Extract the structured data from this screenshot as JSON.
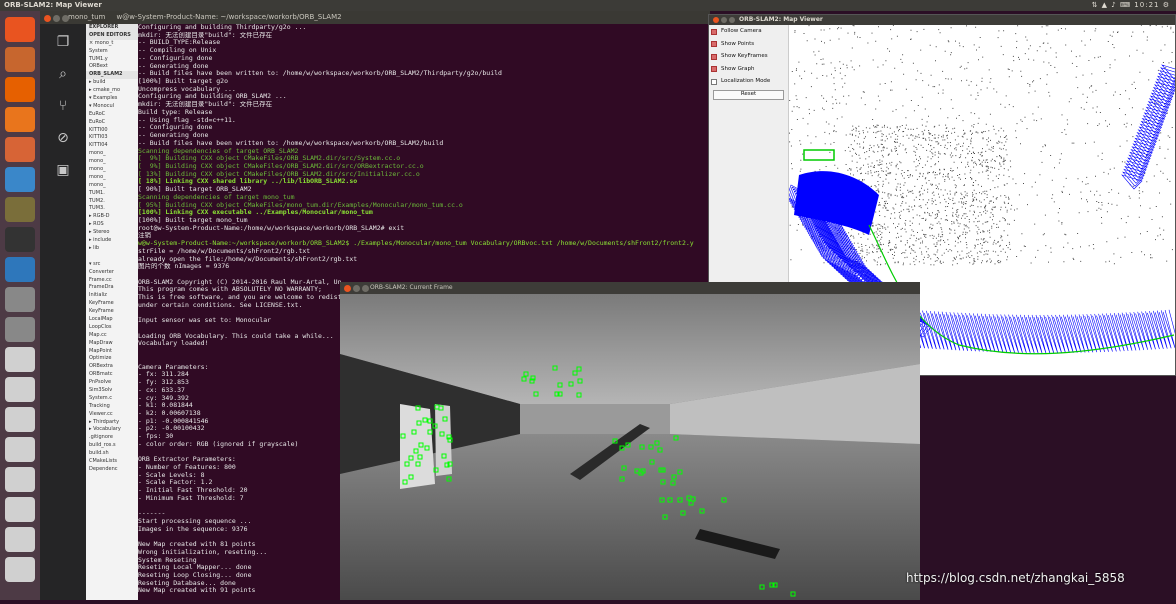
{
  "topbar": {
    "title": "ORB-SLAM2: Map Viewer",
    "clock": "10:21"
  },
  "launcher": {
    "icons": [
      "ubuntu-dash-icon",
      "files-icon",
      "firefox-icon",
      "libreoffice-icon",
      "software-center-icon",
      "chromium-icon",
      "sublime-icon",
      "terminal-icon",
      "settings-icon",
      "help-icon",
      "help-icon",
      "disk-icon",
      "disk-icon",
      "disk-icon",
      "disk-icon",
      "disk-icon",
      "disk-icon",
      "disk-icon",
      "disk-icon"
    ]
  },
  "terminal": {
    "title": "mono_tum",
    "title2": "w@w-System-Product-Name: ~/workspace/workorb/ORB_SLAM2",
    "lines": [
      {
        "t": "Configuring and building Thirdparty/g2o ...",
        "c": ""
      },
      {
        "t": "mkdir: 无法创建目录\"build\": 文件已存在",
        "c": ""
      },
      {
        "t": "-- BUILD_TYPE:Release",
        "c": ""
      },
      {
        "t": "-- Compiling on Unix",
        "c": ""
      },
      {
        "t": "-- Configuring done",
        "c": ""
      },
      {
        "t": "-- Generating done",
        "c": ""
      },
      {
        "t": "-- Build files have been written to: /home/w/workspace/workorb/ORB_SLAM2/Thirdparty/g2o/build",
        "c": ""
      },
      {
        "t": "[100%] Built target g2o",
        "c": ""
      },
      {
        "t": "Uncompress vocabulary ...",
        "c": ""
      },
      {
        "t": "Configuring and building ORB_SLAM2 ...",
        "c": ""
      },
      {
        "t": "mkdir: 无法创建目录\"build\": 文件已存在",
        "c": ""
      },
      {
        "t": "Build type: Release",
        "c": ""
      },
      {
        "t": "-- Using flag -std=c++11.",
        "c": ""
      },
      {
        "t": "-- Configuring done",
        "c": ""
      },
      {
        "t": "-- Generating done",
        "c": ""
      },
      {
        "t": "-- Build files have been written to: /home/w/workspace/workorb/ORB_SLAM2/build",
        "c": ""
      },
      {
        "t": "Scanning dependencies of target ORB_SLAM2",
        "c": "g"
      },
      {
        "t": "[  9%] Building CXX object CMakeFiles/ORB_SLAM2.dir/src/System.cc.o",
        "c": "g"
      },
      {
        "t": "[  9%] Building CXX object CMakeFiles/ORB_SLAM2.dir/src/ORBextractor.cc.o",
        "c": "g"
      },
      {
        "t": "[ 13%] Building CXX object CMakeFiles/ORB_SLAM2.dir/src/Initializer.cc.o",
        "c": "g"
      },
      {
        "t": "[ 18%] Linking CXX shared library ../lib/libORB_SLAM2.so",
        "c": "gb"
      },
      {
        "t": "[ 90%] Built target ORB_SLAM2",
        "c": ""
      },
      {
        "t": "Scanning dependencies of target mono_tum",
        "c": "g"
      },
      {
        "t": "[ 95%] Building CXX object CMakeFiles/mono_tum.dir/Examples/Monocular/mono_tum.cc.o",
        "c": "g"
      },
      {
        "t": "[100%] Linking CXX executable ../Examples/Monocular/mono_tum",
        "c": "gb"
      },
      {
        "t": "[100%] Built target mono_tum",
        "c": ""
      },
      {
        "t": "root@w-System-Product-Name:/home/w/workspace/workorb/ORB_SLAM2# exit",
        "c": ""
      },
      {
        "t": "注销",
        "c": ""
      },
      {
        "t": "w@w-System-Product-Name:~/workspace/workorb/ORB_SLAM2$ ./Examples/Monocular/mono_tum Vocabulary/ORBvoc.txt /home/w/Documents/shFront2/front2.y",
        "c": "pr"
      },
      {
        "t": "strFile = /home/w/Documents/shFront2/rgb.txt",
        "c": ""
      },
      {
        "t": "already open the file:/home/w/Documents/shFront2/rgb.txt",
        "c": ""
      },
      {
        "t": "图片的个数 nImages = 9376",
        "c": ""
      },
      {
        "t": "",
        "c": ""
      },
      {
        "t": "ORB-SLAM2 Copyright (C) 2014-2016 Raul Mur-Artal, Un",
        "c": ""
      },
      {
        "t": "This program comes with ABSOLUTELY NO WARRANTY;",
        "c": ""
      },
      {
        "t": "This is free software, and you are welcome to redist",
        "c": ""
      },
      {
        "t": "under certain conditions. See LICENSE.txt.",
        "c": ""
      },
      {
        "t": "",
        "c": ""
      },
      {
        "t": "Input sensor was set to: Monocular",
        "c": ""
      },
      {
        "t": "",
        "c": ""
      },
      {
        "t": "Loading ORB Vocabulary. This could take a while...",
        "c": ""
      },
      {
        "t": "Vocabulary loaded!",
        "c": ""
      },
      {
        "t": "",
        "c": ""
      },
      {
        "t": "",
        "c": ""
      },
      {
        "t": "Camera Parameters:",
        "c": ""
      },
      {
        "t": "- fx: 311.284",
        "c": ""
      },
      {
        "t": "- fy: 312.853",
        "c": ""
      },
      {
        "t": "- cx: 633.37",
        "c": ""
      },
      {
        "t": "- cy: 349.392",
        "c": ""
      },
      {
        "t": "- k1: 0.081844",
        "c": ""
      },
      {
        "t": "- k2: 0.00607138",
        "c": ""
      },
      {
        "t": "- p1: -0.000841546",
        "c": ""
      },
      {
        "t": "- p2: -0.00100432",
        "c": ""
      },
      {
        "t": "- fps: 30",
        "c": ""
      },
      {
        "t": "- color order: RGB (ignored if grayscale)",
        "c": ""
      },
      {
        "t": "",
        "c": ""
      },
      {
        "t": "ORB Extractor Parameters:",
        "c": ""
      },
      {
        "t": "- Number of Features: 800",
        "c": ""
      },
      {
        "t": "- Scale Levels: 8",
        "c": ""
      },
      {
        "t": "- Scale Factor: 1.2",
        "c": ""
      },
      {
        "t": "- Initial Fast Threshold: 20",
        "c": ""
      },
      {
        "t": "- Minimum Fast Threshold: 7",
        "c": ""
      },
      {
        "t": "",
        "c": ""
      },
      {
        "t": "-------",
        "c": ""
      },
      {
        "t": "Start processing sequence ...",
        "c": ""
      },
      {
        "t": "Images in the sequence: 9376",
        "c": ""
      },
      {
        "t": "",
        "c": ""
      },
      {
        "t": "New Map created with 81 points",
        "c": ""
      },
      {
        "t": "Wrong initialization, reseting...",
        "c": ""
      },
      {
        "t": "System Reseting",
        "c": ""
      },
      {
        "t": "Reseting Local Mapper... done",
        "c": ""
      },
      {
        "t": "Reseting Loop Closing... done",
        "c": ""
      },
      {
        "t": "Reseting Database... done",
        "c": ""
      },
      {
        "t": "New Map created with 91 points",
        "c": ""
      }
    ]
  },
  "explorer": {
    "items": [
      {
        "t": "EXPLORER",
        "s": 1
      },
      {
        "t": "OPEN EDITORS",
        "s": 1
      },
      {
        "t": "× mono_t",
        "s": 0
      },
      {
        "t": "  System",
        "s": 0
      },
      {
        "t": "  TUM1.y",
        "s": 0
      },
      {
        "t": "  ORBext",
        "s": 0
      },
      {
        "t": "ORB_SLAM2",
        "s": 1
      },
      {
        "t": "▸ build",
        "s": 0
      },
      {
        "t": "▸ cmake_mo",
        "s": 0
      },
      {
        "t": "▾ Examples",
        "s": 0
      },
      {
        "t": " ▾ Monocul",
        "s": 0
      },
      {
        "t": "  EuRoC",
        "s": 0
      },
      {
        "t": "  EuRoC",
        "s": 0
      },
      {
        "t": "  KITTI00",
        "s": 0
      },
      {
        "t": "  KITTI03",
        "s": 0
      },
      {
        "t": "  KITTI04",
        "s": 0
      },
      {
        "t": "  mono_",
        "s": 0
      },
      {
        "t": "  mono_",
        "s": 0
      },
      {
        "t": "  mono_",
        "s": 0
      },
      {
        "t": "  mono_",
        "s": 0
      },
      {
        "t": "  mono_",
        "s": 0
      },
      {
        "t": "  TUM1.",
        "s": 0
      },
      {
        "t": "  TUM2.",
        "s": 0
      },
      {
        "t": "  TUM3.",
        "s": 0
      },
      {
        "t": " ▸ RGB-D",
        "s": 0
      },
      {
        "t": " ▸ ROS",
        "s": 0
      },
      {
        "t": " ▸ Stereo",
        "s": 0
      },
      {
        "t": "▸ include",
        "s": 0
      },
      {
        "t": "▸ lib",
        "s": 0
      },
      {
        "t": "",
        "s": 0
      },
      {
        "t": "▾ src",
        "s": 0
      },
      {
        "t": " Converter",
        "s": 0
      },
      {
        "t": " Frame.cc",
        "s": 0
      },
      {
        "t": " FrameDra",
        "s": 0
      },
      {
        "t": " Initializ",
        "s": 0
      },
      {
        "t": " KeyFrame",
        "s": 0
      },
      {
        "t": " KeyFrame",
        "s": 0
      },
      {
        "t": " LocalMap",
        "s": 0
      },
      {
        "t": " LoopClos",
        "s": 0
      },
      {
        "t": " Map.cc",
        "s": 0
      },
      {
        "t": " MapDraw",
        "s": 0
      },
      {
        "t": " MapPoint",
        "s": 0
      },
      {
        "t": " Optimize",
        "s": 0
      },
      {
        "t": " ORBextra",
        "s": 0
      },
      {
        "t": " ORBmatc",
        "s": 0
      },
      {
        "t": " PnPsolve",
        "s": 0
      },
      {
        "t": " Sim3Solv",
        "s": 0
      },
      {
        "t": " System.c",
        "s": 0
      },
      {
        "t": " Tracking",
        "s": 0
      },
      {
        "t": " Viewer.cc",
        "s": 0
      },
      {
        "t": "▸ Thirdparty",
        "s": 0
      },
      {
        "t": "▸ Vocabulary",
        "s": 0
      },
      {
        "t": " .gitignore",
        "s": 0
      },
      {
        "t": " build_ros.s",
        "s": 0
      },
      {
        "t": " build.sh",
        "s": 0
      },
      {
        "t": " CMakeLists",
        "s": 0
      },
      {
        "t": " Dependenc",
        "s": 0
      }
    ]
  },
  "mapviewer": {
    "title": "ORB-SLAM2: Map Viewer",
    "menu": [
      {
        "label": "Follow Camera",
        "checked": true
      },
      {
        "label": "Show Points",
        "checked": true
      },
      {
        "label": "Show KeyFrames",
        "checked": true
      },
      {
        "label": "Show Graph",
        "checked": true
      },
      {
        "label": "Localization Mode",
        "checked": false
      }
    ],
    "reset": "Reset"
  },
  "currentframe": {
    "title": "ORB-SLAM2: Current Frame"
  },
  "watermark": {
    "text": "https://blog.csdn.net/zhangkai_5858"
  },
  "colors": {
    "keyframe": "#0000ff",
    "graph": "#00cc00",
    "feature": "#00ff00"
  }
}
